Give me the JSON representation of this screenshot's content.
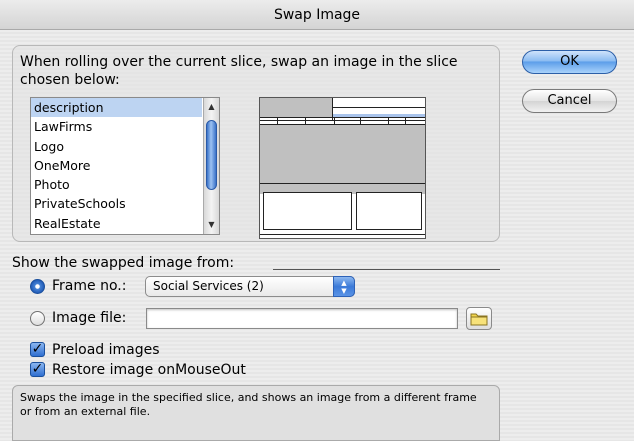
{
  "window": {
    "title": "Swap Image"
  },
  "slice_group": {
    "prompt": "When rolling over the current slice, swap an image in the slice chosen below:",
    "slices": [
      {
        "label": "description",
        "selected": true
      },
      {
        "label": "LawFirms",
        "selected": false
      },
      {
        "label": "Logo",
        "selected": false
      },
      {
        "label": "OneMore",
        "selected": false
      },
      {
        "label": "Photo",
        "selected": false
      },
      {
        "label": "PrivateSchools",
        "selected": false
      },
      {
        "label": "RealEstate",
        "selected": false
      }
    ]
  },
  "source": {
    "heading": "Show the swapped image from:",
    "frame_option": {
      "label": "Frame no.:",
      "selected": true,
      "value": "Social Services (2)"
    },
    "file_option": {
      "label": "Image file:",
      "selected": false,
      "value": ""
    }
  },
  "options": {
    "preload": {
      "label": "Preload images",
      "checked": true
    },
    "restore": {
      "label": "Restore image onMouseOut",
      "checked": true
    }
  },
  "help": {
    "text": "Swaps the image in the specified slice, and shows an image from a different frame or from an external file."
  },
  "buttons": {
    "ok": "OK",
    "cancel": "Cancel"
  },
  "colors": {
    "accent": "#3b7ad8",
    "selection": "#bdd4f2",
    "preview_fill": "#c0c0c0",
    "preview_highlight": "#a9c4ec"
  },
  "icons": {
    "folder": "folder-icon",
    "popup": "up-down-arrows-icon",
    "check": "checkmark-icon"
  }
}
